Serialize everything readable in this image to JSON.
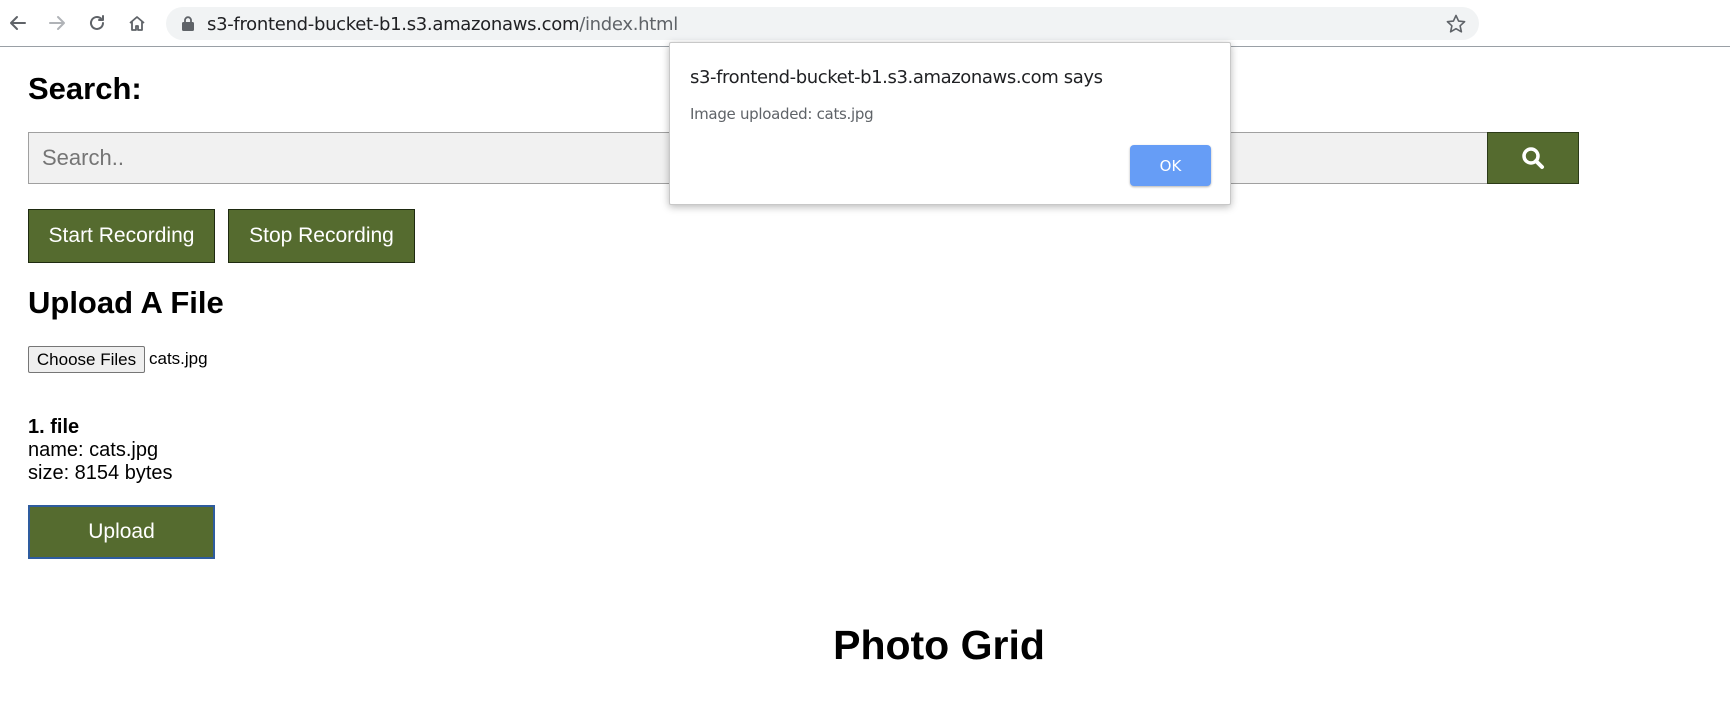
{
  "browser": {
    "url_host": "s3-frontend-bucket-b1.s3.amazonaws.com",
    "url_path": "/index.html",
    "icons": [
      "back-icon",
      "forward-icon",
      "reload-icon",
      "home-icon",
      "lock-icon",
      "star-icon"
    ]
  },
  "search": {
    "heading": "Search:",
    "placeholder": "Search..",
    "button_icon": "search-icon"
  },
  "recording": {
    "start_label": "Start Recording",
    "stop_label": "Stop Recording"
  },
  "upload": {
    "heading": "Upload A File",
    "choose_label": "Choose Files",
    "chosen_file": "cats.jpg",
    "file_title": "1. file",
    "file_name": "name: cats.jpg",
    "file_size": "size: 8154 bytes",
    "upload_label": "Upload"
  },
  "grid": {
    "heading": "Photo Grid"
  },
  "dialog": {
    "title": "s3-frontend-bucket-b1.s3.amazonaws.com says",
    "message": "Image uploaded: cats.jpg",
    "ok_label": "OK"
  },
  "colors": {
    "button_green": "#556b2f",
    "dialog_ok_blue": "#669df6",
    "focus_border": "#2e5c9e"
  }
}
